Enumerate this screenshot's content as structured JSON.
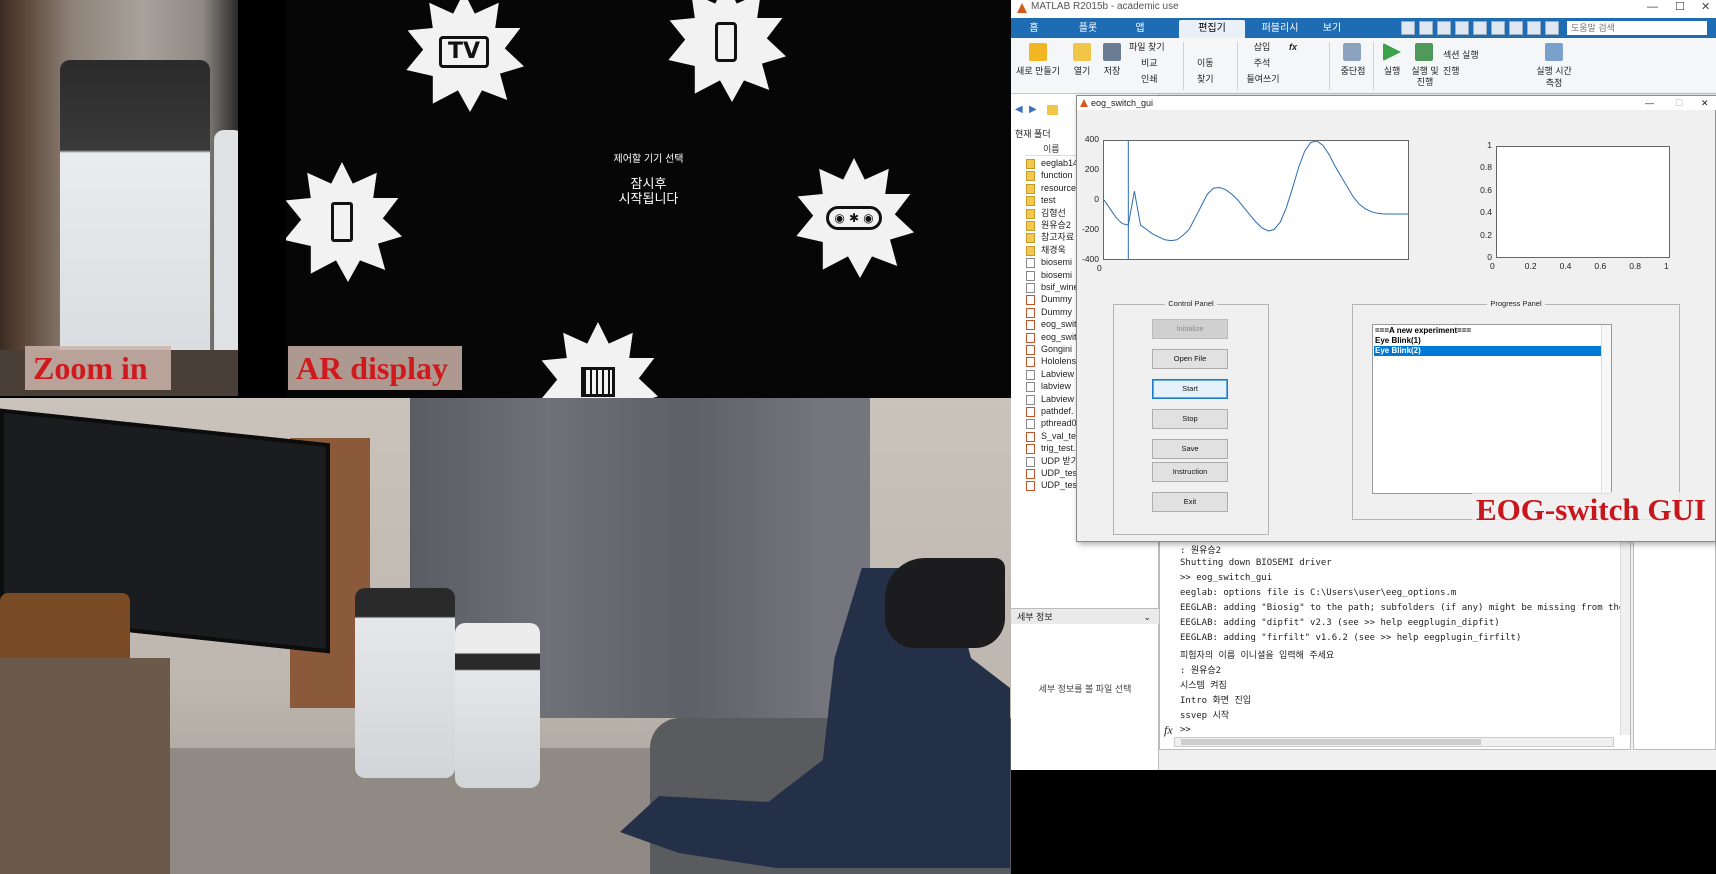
{
  "captions": {
    "zoom_in": "Zoom in",
    "ar_display": "AR display",
    "eog_switch_gui": "EOG-switch GUI"
  },
  "ar": {
    "title": "제어할 기기 선택",
    "subtitle_line1": "잠시후",
    "subtitle_line2": "시작됩니다",
    "icons": [
      "tv-icon",
      "air-purifier-icon",
      "humidifier-icon",
      "bluetooth-speaker-icon",
      "heater-icon"
    ],
    "tv_label": "TV"
  },
  "matlab": {
    "window_title": "MATLAB R2015b - academic use",
    "tabs": [
      "홈",
      "플롯",
      "앱",
      "편집기",
      "퍼블리시",
      "보기"
    ],
    "active_tab": "편집기",
    "search_placeholder": "도움말 검색",
    "ribbon": {
      "new": "새로 만들기",
      "open": "열기",
      "save": "저장",
      "find_files": "파일 찾기",
      "compare": "비교",
      "print": "인쇄",
      "navigate": "이동",
      "find": "찾기",
      "insert": "삽입",
      "comment": "주석",
      "indent": "들여쓰기",
      "fx": "fx",
      "breakpoints": "중단점",
      "run": "실행",
      "run_advance": "실행 및 진행",
      "run_section": "섹션 실행",
      "advance": "진행",
      "run_time_line1": "실행 시간",
      "run_time_line2": "측정"
    },
    "current_folder": "현재 폴더",
    "name_column": "이름",
    "files": [
      {
        "name": "eeglab14",
        "kind": "folder"
      },
      {
        "name": "function",
        "kind": "folder"
      },
      {
        "name": "resource",
        "kind": "folder"
      },
      {
        "name": "test",
        "kind": "folder"
      },
      {
        "name": "김형선",
        "kind": "folder"
      },
      {
        "name": "원유승2",
        "kind": "folder"
      },
      {
        "name": "참고자료",
        "kind": "folder"
      },
      {
        "name": "채경욱",
        "kind": "folder"
      },
      {
        "name": "biosemi",
        "kind": "file"
      },
      {
        "name": "biosemi",
        "kind": "file"
      },
      {
        "name": "bsif_wine",
        "kind": "file"
      },
      {
        "name": "Dummy",
        "kind": "m"
      },
      {
        "name": "Dummy",
        "kind": "m"
      },
      {
        "name": "eog_swit",
        "kind": "m"
      },
      {
        "name": "eog_swit",
        "kind": "m"
      },
      {
        "name": "Gongini",
        "kind": "m"
      },
      {
        "name": "Hololens",
        "kind": "m"
      },
      {
        "name": "Labview",
        "kind": "file"
      },
      {
        "name": "labview",
        "kind": "file"
      },
      {
        "name": "Labview",
        "kind": "file"
      },
      {
        "name": "pathdef.",
        "kind": "m"
      },
      {
        "name": "pthread0",
        "kind": "file"
      },
      {
        "name": "S_val_tes",
        "kind": "m"
      },
      {
        "name": "trig_test.",
        "kind": "m"
      },
      {
        "name": "UDP 받기",
        "kind": "file"
      },
      {
        "name": "UDP_tes",
        "kind": "m"
      },
      {
        "name": "UDP_tes",
        "kind": "m"
      }
    ],
    "details_header": "세부 정보",
    "details_message": "세부 정보를 볼 파일 선택",
    "command_lines": [
      ": 원유승2",
      "Shutting down BIOSEMI driver",
      ">> eog_switch_gui",
      "eeglab: options file is C:\\Users\\user\\eeg_options.m",
      "EEGLAB: adding \"Biosig\" to the path; subfolders (if any) might be missing from the",
      "EEGLAB: adding \"dipfit\" v2.3 (see >> help eegplugin_dipfit)",
      "EEGLAB: adding \"firfilt\" v1.6.2 (see >> help eegplugin_firfilt)",
      "피험자의 이름 이니셜을 입력해 주세요",
      ": 원유승2",
      "시스템 켜짐",
      "Intro 화면 진입",
      "ssvep 시작"
    ],
    "prompt": ">>"
  },
  "gui": {
    "title": "eog_switch_gui",
    "left_plot": {
      "y_ticks": [
        "400",
        "200",
        "0",
        "-200",
        "-400"
      ],
      "x_ticks": [
        "0"
      ]
    },
    "right_plot": {
      "y_ticks": [
        "1",
        "0.8",
        "0.6",
        "0.4",
        "0.2",
        "0"
      ],
      "x_ticks": [
        "0",
        "0.2",
        "0.4",
        "0.6",
        "0.8",
        "1"
      ]
    },
    "control_panel": {
      "title": "Control Panel",
      "buttons": [
        {
          "label": "Initialize",
          "state": "disabled"
        },
        {
          "label": "Open File",
          "state": "normal"
        },
        {
          "label": "Start",
          "state": "focused"
        },
        {
          "label": "Stop",
          "state": "normal"
        },
        {
          "label": "Save",
          "state": "normal"
        },
        {
          "label": "Instruction",
          "state": "normal"
        },
        {
          "label": "Exit",
          "state": "normal"
        }
      ]
    },
    "progress_panel": {
      "title": "Progress Panel",
      "items": [
        "===A new experiment===",
        "Eye Blink(1)",
        "Eye Blink(2)"
      ],
      "selected_index": 2
    }
  },
  "chart_data": {
    "type": "line",
    "title": "",
    "xlabel": "",
    "ylabel": "",
    "ylim": [
      -400,
      400
    ],
    "x_ticks_shown": [
      "0"
    ],
    "series": [
      {
        "x": [
          0,
          2,
          4,
          6,
          8,
          10,
          12,
          14,
          16,
          18,
          20,
          22,
          24,
          26,
          28,
          30,
          32,
          34,
          36,
          38,
          40,
          42,
          44,
          46,
          48,
          50,
          52,
          54,
          56,
          58,
          60,
          62,
          64,
          66,
          68,
          70,
          72,
          74,
          76,
          78,
          80,
          82,
          84,
          86,
          88,
          90,
          92,
          94,
          96,
          98,
          100
        ],
        "y": [
          0,
          -60,
          -120,
          -160,
          -170,
          60,
          -170,
          -200,
          -230,
          -250,
          -270,
          -275,
          -270,
          -240,
          -200,
          -120,
          -40,
          40,
          80,
          85,
          70,
          40,
          0,
          -50,
          -100,
          -150,
          -190,
          -210,
          -200,
          -150,
          -50,
          80,
          220,
          330,
          390,
          400,
          370,
          310,
          230,
          160,
          90,
          20,
          -30,
          -60,
          -80,
          -90,
          -95,
          -95,
          -95,
          -95,
          -95
        ]
      }
    ],
    "cursor_x": 8
  }
}
